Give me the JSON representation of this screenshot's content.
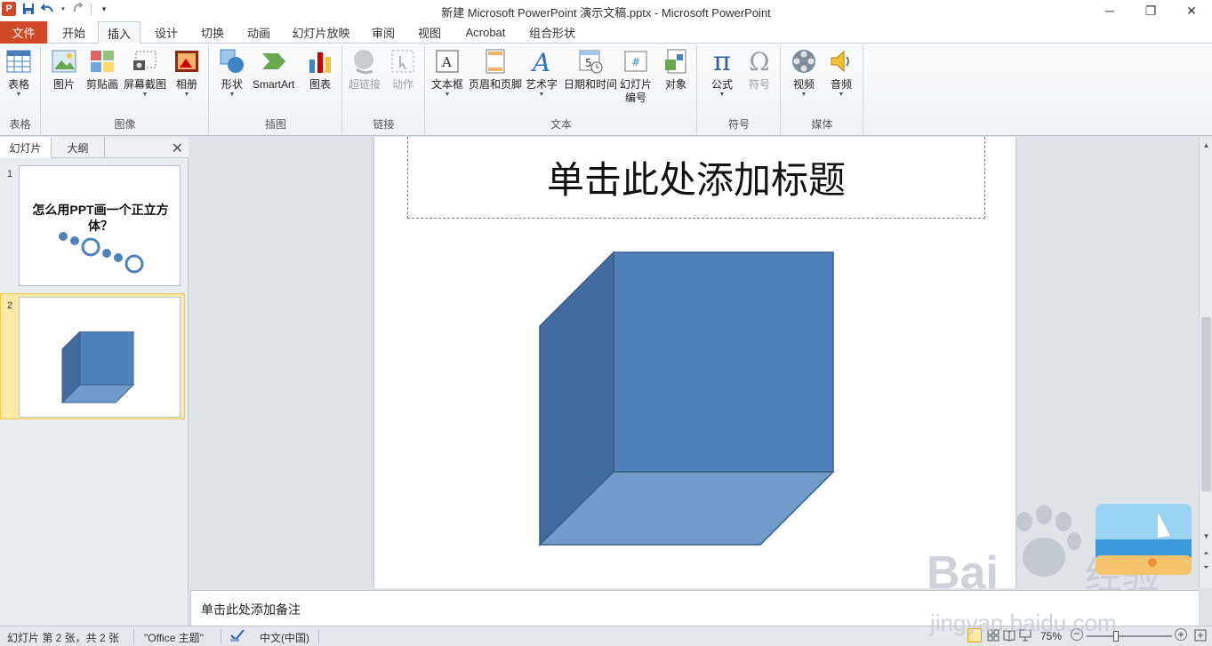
{
  "window": {
    "title": "新建 Microsoft PowerPoint 演示文稿.pptx - Microsoft PowerPoint",
    "app_logo": "P",
    "minimize": "─",
    "maximize": "❐",
    "close": "✕"
  },
  "qat": {
    "save_icon": "save-icon",
    "undo_icon": "undo-icon",
    "redo_icon": "redo-icon",
    "customize_icon": "dropdown-icon"
  },
  "tabs": [
    {
      "label": "文件"
    },
    {
      "label": "开始"
    },
    {
      "label": "插入"
    },
    {
      "label": "设计"
    },
    {
      "label": "切换"
    },
    {
      "label": "动画"
    },
    {
      "label": "幻灯片放映"
    },
    {
      "label": "审阅"
    },
    {
      "label": "视图"
    },
    {
      "label": "Acrobat"
    },
    {
      "label": "组合形状"
    }
  ],
  "ribbon": {
    "groups": [
      {
        "label": "表格"
      },
      {
        "label": "图像"
      },
      {
        "label": "插图"
      },
      {
        "label": "链接"
      },
      {
        "label": "文本"
      },
      {
        "label": "符号"
      },
      {
        "label": "媒体"
      }
    ],
    "buttons": {
      "table": "表格",
      "picture": "图片",
      "clipart": "剪贴画",
      "screenshot": "屏幕截图",
      "album": "相册",
      "shapes": "形状",
      "smartart": "SmartArt",
      "chart": "图表",
      "hyperlink": "超链接",
      "action": "动作",
      "textbox": "文本框",
      "header_footer": "页眉和页脚",
      "wordart": "艺术字",
      "datetime": "日期和时间",
      "slide_number_1": "幻灯片",
      "slide_number_2": "编号",
      "object": "对象",
      "equation": "公式",
      "symbol": "符号",
      "video": "视频",
      "audio": "音频"
    },
    "glyphs": {
      "pi": "π",
      "omega": "Ω",
      "hash": "#",
      "five": "5"
    }
  },
  "left_pane": {
    "tabs": [
      {
        "label": "幻灯片"
      },
      {
        "label": "大纲"
      }
    ],
    "close": "✕",
    "slides": [
      {
        "number": "1",
        "title": "怎么用PPT画一个正立方体？",
        "title_line1": "怎么用PPT画一个正立方",
        "title_line2": "体？"
      },
      {
        "number": "2"
      }
    ],
    "selected_slide": 2
  },
  "slide": {
    "title_placeholder": "单击此处添加标题",
    "cube_colors": {
      "front": "#4f81bd",
      "side": "#416b9e",
      "bottom": "#729aca",
      "stroke": "#385d8a"
    }
  },
  "notes": {
    "placeholder": "单击此处添加备注"
  },
  "status": {
    "slide_info": "幻灯片 第 2 张，共 2 张",
    "theme": "\"Office 主题\"",
    "language": "中文(中国)",
    "zoom": "75%"
  },
  "watermark": {
    "brand_prefix": "Bai",
    "brand_suffix": "经验",
    "url": "jingyan.baidu.com"
  }
}
